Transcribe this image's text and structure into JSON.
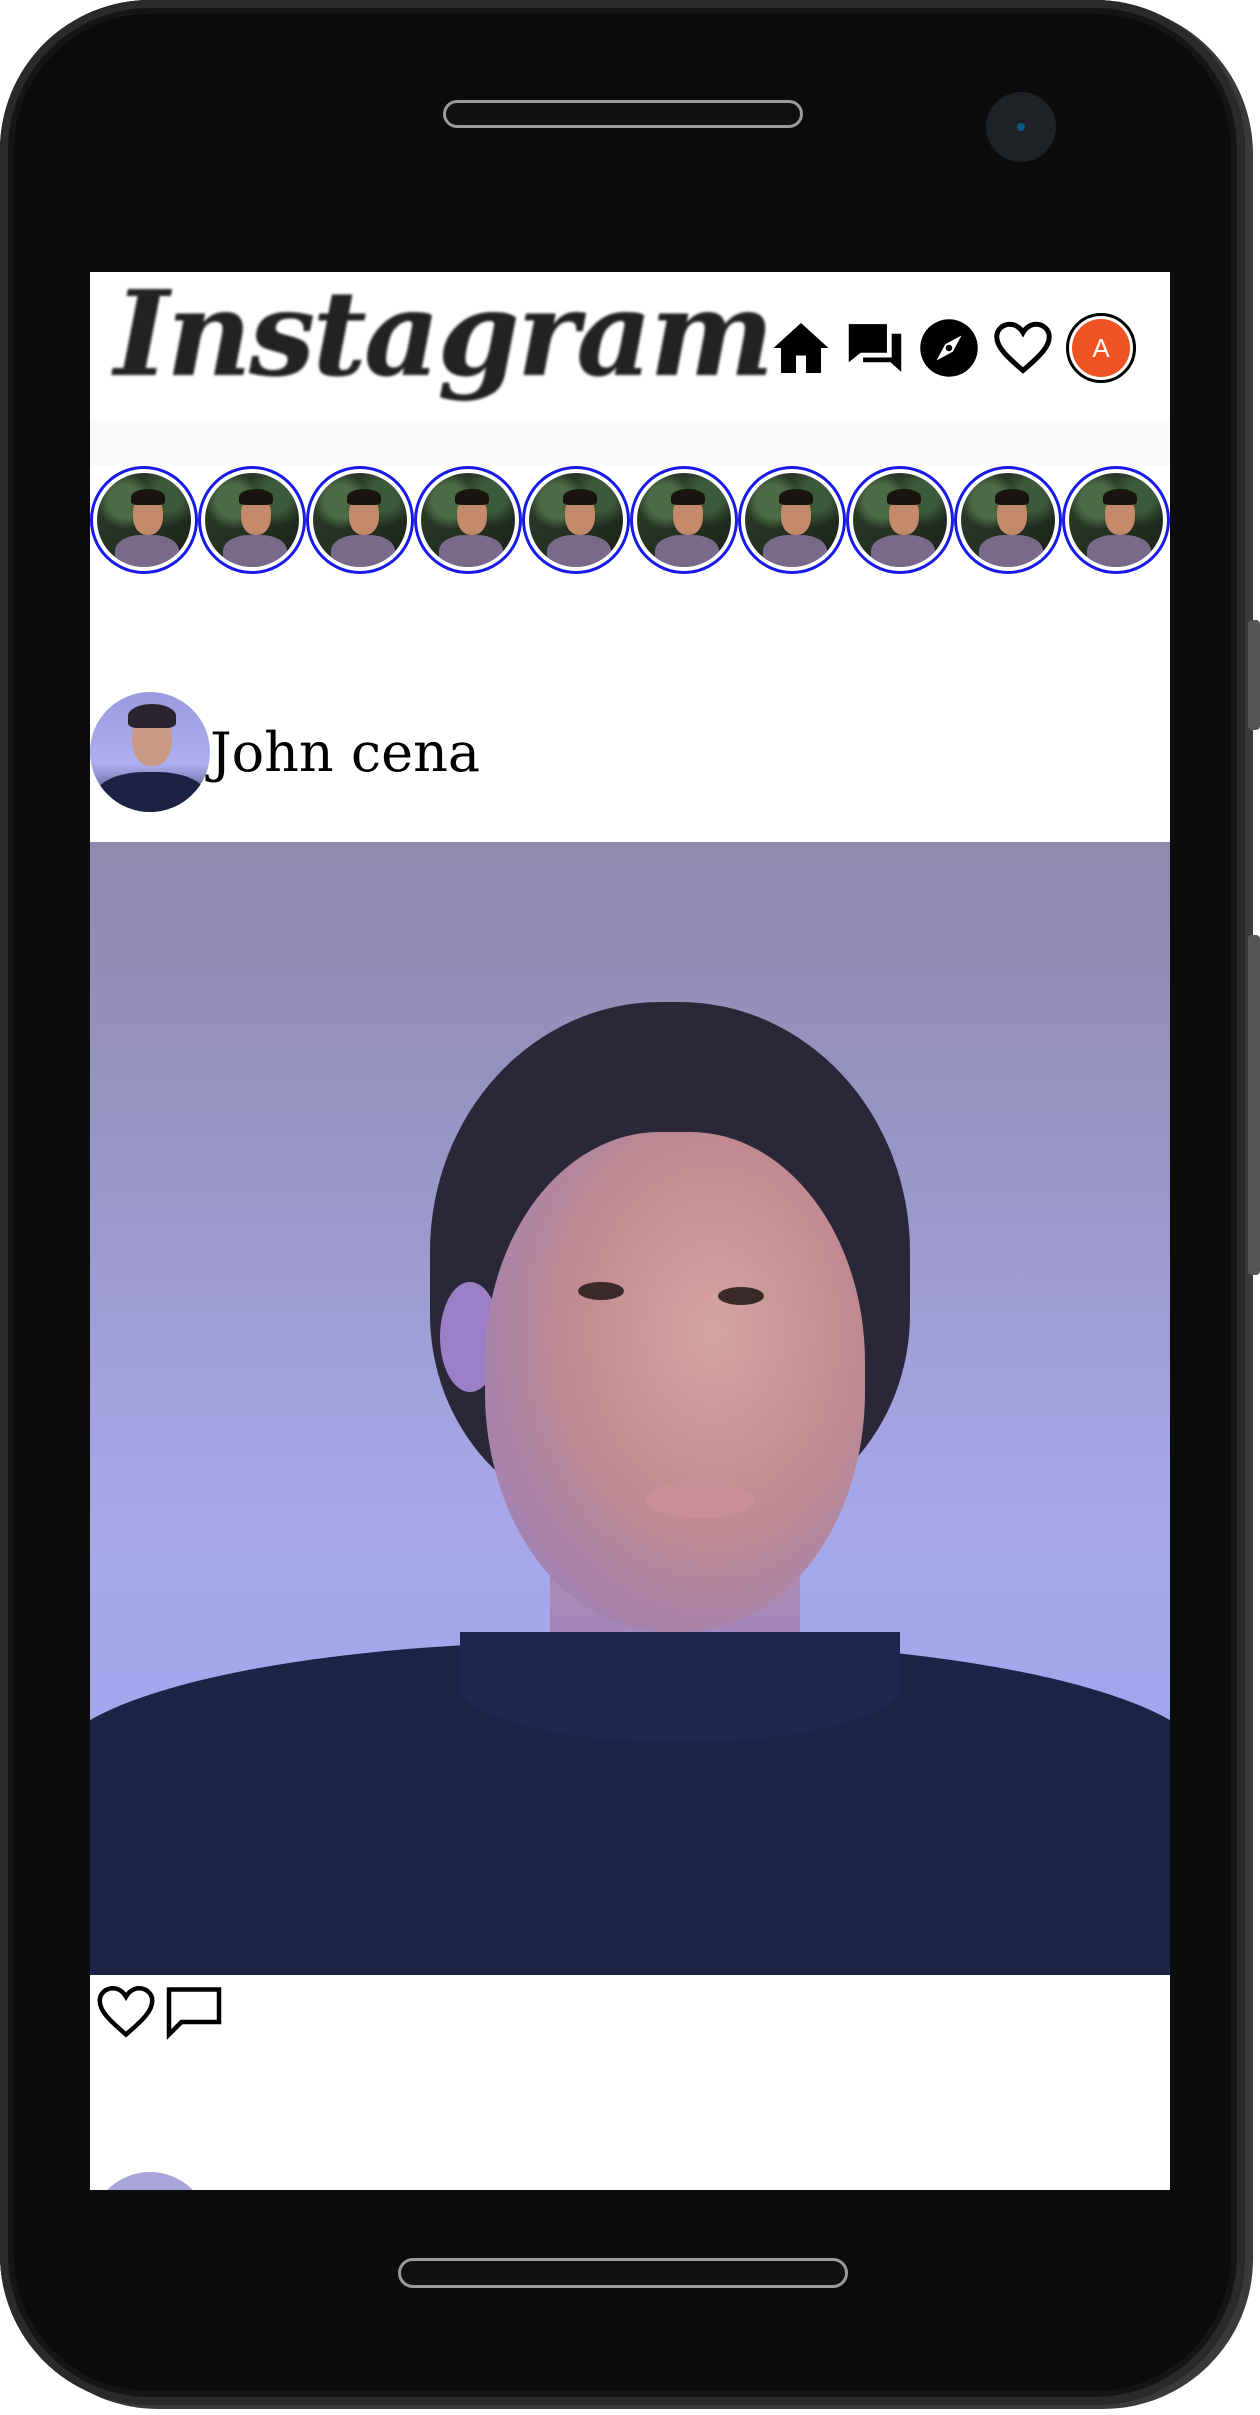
{
  "app": {
    "logo_text": "Instagram"
  },
  "nav": {
    "icons": [
      "home-icon",
      "messages-icon",
      "explore-icon",
      "heart-icon"
    ],
    "profile_initial": "A",
    "profile_color": "#f05323"
  },
  "stories": {
    "count": 10,
    "ring_color": "#1a1ae6"
  },
  "post": {
    "username": "John cena",
    "actions": [
      "heart-icon",
      "comment-icon"
    ]
  }
}
